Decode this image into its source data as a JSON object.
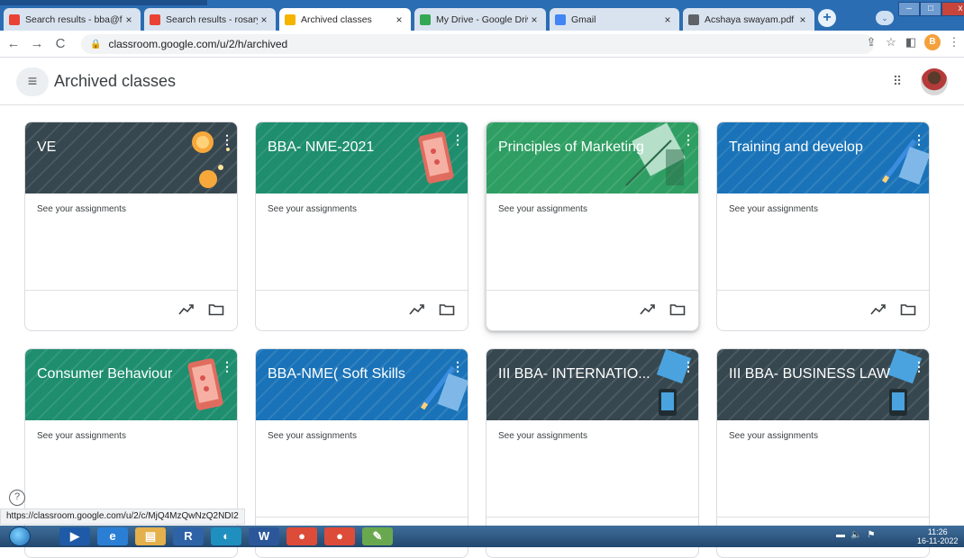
{
  "browser": {
    "tabs": [
      {
        "title": "Search results - bba@f",
        "icon": "gmail-icon",
        "fav_color": "#ea4335"
      },
      {
        "title": "Search results - rosaryi",
        "icon": "gmail-icon",
        "fav_color": "#ea4335"
      },
      {
        "title": "Archived classes",
        "icon": "classroom-icon",
        "fav_color": "#f4b400",
        "active": true
      },
      {
        "title": "My Drive - Google Driv",
        "icon": "drive-icon",
        "fav_color": "#34a853"
      },
      {
        "title": "Gmail",
        "icon": "google-icon",
        "fav_color": "#4285f4"
      },
      {
        "title": "Acshaya swayam.pdf",
        "icon": "globe-icon",
        "fav_color": "#5f6368"
      }
    ],
    "close_glyph": "×",
    "url": "classroom.google.com/u/2/h/archived",
    "profile_initial": "B"
  },
  "header": {
    "title": "Archived classes"
  },
  "cards": [
    {
      "title": "VE",
      "subtitle": "See your assignments",
      "color": "#37474f",
      "deco": "bulb"
    },
    {
      "title": "BBA- NME-2021",
      "subtitle": "See your assignments",
      "color": "#1e8e6e",
      "deco": "phone"
    },
    {
      "title": "Principles of Marketing",
      "subtitle": "See your assignments",
      "color": "#2e9e62",
      "deco": "book"
    },
    {
      "title": "Training and develop",
      "subtitle": "See your assignments",
      "color": "#1a73b8",
      "deco": "pencil"
    },
    {
      "title": "Consumer Behaviour",
      "subtitle": "See your assignments",
      "color": "#1e8e6e",
      "deco": "phone"
    },
    {
      "title": "BBA-NME( Soft Skills",
      "subtitle": "See your assignments",
      "color": "#1a73b8",
      "deco": "pencil"
    },
    {
      "title": "III BBA- INTERNATIO...",
      "subtitle": "See your assignments",
      "color": "#37474f",
      "deco": "tablet"
    },
    {
      "title": "III BBA- BUSINESS LAW",
      "subtitle": "See your assignments",
      "color": "#37474f",
      "deco": "tablet"
    }
  ],
  "status_url": "https://classroom.google.com/u/2/c/MjQ4MzQwNzQ2NDI2",
  "taskbar": {
    "apps": [
      "media-player",
      "ie",
      "file-explorer",
      "R",
      "edge",
      "word",
      "chrome",
      "chrome",
      "paint"
    ],
    "r_label": "R",
    "time": "11:26",
    "date": "16-11-2022"
  }
}
